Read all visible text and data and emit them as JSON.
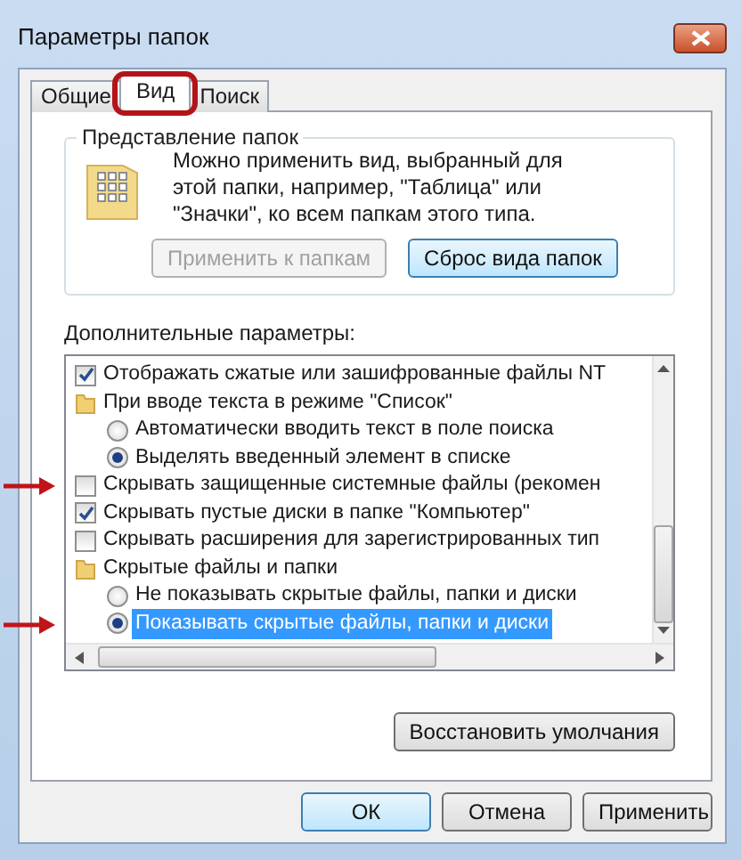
{
  "window": {
    "title": "Параметры папок"
  },
  "tabs": [
    {
      "label": "Общие",
      "selected": false
    },
    {
      "label": "Вид",
      "selected": true
    },
    {
      "label": "Поиск",
      "selected": false
    }
  ],
  "folder_views": {
    "legend": "Представление папок",
    "description": "Можно применить вид, выбранный для этой папки, например, \"Таблица\" или \"Значки\", ко всем папкам этого типа.",
    "buttons": [
      {
        "label": "Применить к папкам",
        "disabled": true
      },
      {
        "label": "Сброс вида папок",
        "disabled": false
      }
    ]
  },
  "advanced": {
    "label": "Дополнительные параметры:",
    "items": [
      {
        "kind": "checkbox",
        "label": "Отображать сжатые или зашифрованные файлы NT",
        "checked": true,
        "highlighted": false
      },
      {
        "kind": "folder",
        "label": "При вводе текста в режиме \"Список\"",
        "children": [
          {
            "kind": "radio",
            "label": "Автоматически вводить текст в поле поиска",
            "selected": false,
            "highlighted": false
          },
          {
            "kind": "radio",
            "label": "Выделять введенный элемент в списке",
            "selected": true,
            "highlighted": false
          }
        ]
      },
      {
        "kind": "checkbox",
        "label": "Скрывать защищенные системные файлы (рекомен",
        "checked": false,
        "highlighted": false
      },
      {
        "kind": "checkbox",
        "label": "Скрывать пустые диски в папке \"Компьютер\"",
        "checked": true,
        "highlighted": false
      },
      {
        "kind": "checkbox",
        "label": "Скрывать расширения для зарегистрированных тип",
        "checked": false,
        "highlighted": false
      },
      {
        "kind": "folder",
        "label": "Скрытые файлы и папки",
        "children": [
          {
            "kind": "radio",
            "label": "Не показывать скрытые файлы, папки и диски",
            "selected": false,
            "highlighted": false
          },
          {
            "kind": "radio",
            "label": "Показывать скрытые файлы, папки и диски",
            "selected": true,
            "highlighted": true
          }
        ]
      }
    ],
    "restore_button": "Восстановить умолчания"
  },
  "dialog_buttons": [
    "ОК",
    "Отмена",
    "Применить"
  ]
}
